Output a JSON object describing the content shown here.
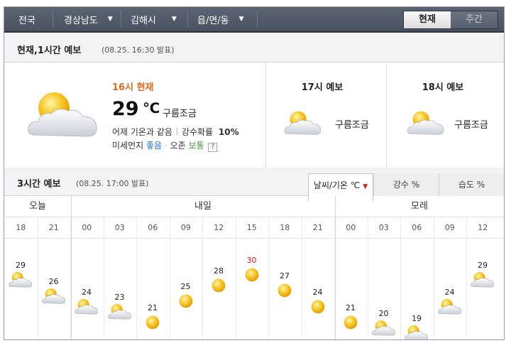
{
  "nav": {
    "items": [
      {
        "label": "전국",
        "dropdown": false
      },
      {
        "label": "경상남도",
        "dropdown": true
      },
      {
        "label": "김해시",
        "dropdown": true
      },
      {
        "label": "읍/면/동",
        "dropdown": true
      }
    ],
    "tabs": {
      "now": "현재",
      "week": "주간"
    }
  },
  "current": {
    "header": "현재,1시간 예보",
    "issued": "(08.25. 16:30 발표)",
    "now": {
      "title": "16시 현재",
      "temp": "29",
      "unit": "℃",
      "condition": "구름조금",
      "yesterday": "어제 기온과 같음",
      "precip_label": "강수확률",
      "precip_value": "10%",
      "dust_label": "미세먼지",
      "dust_value": "좋음",
      "ozone_label": "오존",
      "ozone_value": "보통",
      "help": "?"
    },
    "forecasts": [
      {
        "title": "17시 예보",
        "condition": "구름조금"
      },
      {
        "title": "18시 예보",
        "condition": "구름조금"
      }
    ]
  },
  "three_hour": {
    "header": "3시간 예보",
    "issued": "(08.25. 17:00 발표)",
    "toggles": {
      "weather": "날씨/기온 ℃",
      "precip": "강수 %",
      "humidity": "습도 %"
    },
    "days": [
      "오늘",
      "내일",
      "모레"
    ]
  },
  "colors": {
    "accent_now": "#e26a1a",
    "hot": "#d21b1b",
    "good": "#1a6fc9",
    "normal": "#3c9a2e"
  },
  "chart_data": {
    "type": "line",
    "x": [
      "18",
      "21",
      "00",
      "03",
      "06",
      "09",
      "12",
      "15",
      "18",
      "21",
      "00",
      "03",
      "06",
      "09",
      "12"
    ],
    "values": [
      29,
      26,
      24,
      23,
      21,
      25,
      28,
      30,
      27,
      24,
      21,
      20,
      19,
      24,
      29
    ],
    "icons": [
      "partly-cloudy",
      "partly-cloudy",
      "partly-cloudy",
      "partly-cloudy",
      "sun",
      "sun",
      "sun",
      "sun",
      "sun",
      "sun",
      "sun",
      "partly-cloudy",
      "partly-cloudy",
      "partly-cloudy",
      "partly-cloudy"
    ],
    "highlight": [
      7
    ],
    "ylim": [
      19,
      30
    ]
  }
}
